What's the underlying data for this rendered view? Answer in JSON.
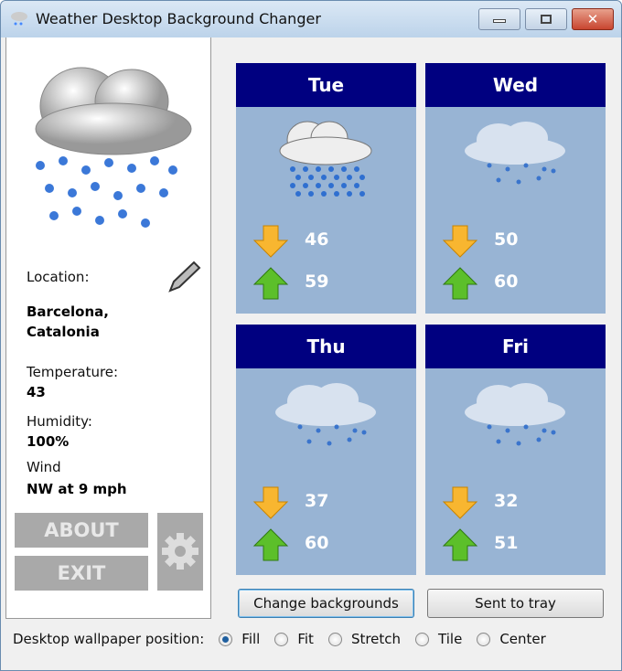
{
  "window": {
    "title": "Weather Desktop Background Changer"
  },
  "current": {
    "location_label": "Location:",
    "location": "Barcelona,",
    "location2": "Catalonia",
    "temperature_label": "Temperature:",
    "temperature": "43",
    "humidity_label": "Humidity:",
    "humidity": "100%",
    "wind_label": "Wind",
    "wind": "NW at 9 mph",
    "icon": "heavy-rain-cloud"
  },
  "buttons": {
    "about": "ABOUT",
    "exit": "EXIT",
    "change": "Change backgrounds",
    "tray": "Sent to tray"
  },
  "forecast": [
    {
      "day": "Tue",
      "low": "46",
      "high": "59",
      "icon": "heavy-rain-cloud"
    },
    {
      "day": "Wed",
      "low": "50",
      "high": "60",
      "icon": "light-rain-cloud"
    },
    {
      "day": "Thu",
      "low": "37",
      "high": "60",
      "icon": "light-rain-cloud"
    },
    {
      "day": "Fri",
      "low": "32",
      "high": "51",
      "icon": "light-rain-cloud"
    }
  ],
  "wallpaper": {
    "label": "Desktop wallpaper position:",
    "options": [
      "Fill",
      "Fit",
      "Stretch",
      "Tile",
      "Center"
    ],
    "selected": "Fill"
  },
  "colors": {
    "header": "#000080",
    "card": "#98b4d4"
  }
}
